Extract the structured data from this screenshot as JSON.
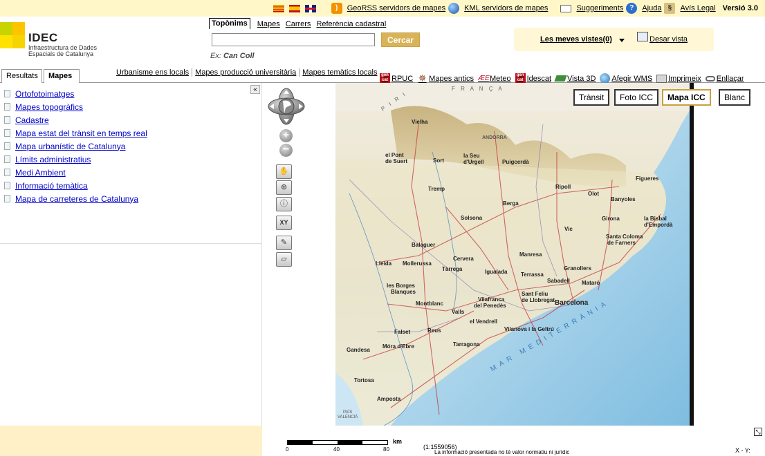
{
  "topbar": {
    "links": {
      "georss": "GeoRSS servidors de mapes",
      "kml": "KML servidors de mapes",
      "suggestions": "Suggeriments",
      "help": "Ajuda",
      "legal": "Avís Legal"
    },
    "version": "Versió 3.0"
  },
  "logo": {
    "title": "IDEC",
    "subtitle_line1": "Infraestructura de Dades",
    "subtitle_line2": "Espacials de Catalunya"
  },
  "search": {
    "tabs": [
      "Topònims",
      "Mapes",
      "Carrers",
      "Referència cadastral"
    ],
    "active_tab": "Topònims",
    "input_value": "",
    "button_label": "Cercar",
    "example_prefix": "Ex:",
    "example_value": "Can Coll"
  },
  "views": {
    "my_views": "Les meves vistes(0)",
    "save_view": "Desar vista"
  },
  "tabs": {
    "resultats": "Resultats",
    "mapes": "Mapes"
  },
  "tool_links": [
    "Urbanisme ens locals",
    "Mapes producció universitària",
    "Mapes temàtics locals"
  ],
  "tool_icons": {
    "rpuc": "RPUC",
    "antics": "Mapes antics",
    "meteo": "Meteo",
    "idescat": "Idescat",
    "vista3d": "Vista 3D",
    "wms": "Afegir WMS",
    "print": "Imprimeix",
    "link": "Enllaçar"
  },
  "maps_list": [
    "Ortofotoimatges",
    "Mapes topogràfics",
    "Cadastre",
    "Mapa estat del trànsit en temps real",
    "Mapa urbanístic de Catalunya",
    "Límits administratius",
    "Medi Ambient",
    "Informació temàtica",
    "Mapa de carreteres de Catalunya"
  ],
  "layer_buttons": {
    "transit": "Trànsit",
    "foto": "Foto ICC",
    "mapa": "Mapa ICC",
    "blanc": "Blanc"
  },
  "map_labels": {
    "vielha": "Vielha",
    "el_pont_de_suert_1": "el Pont",
    "el_pont_de_suert_2": "de Suert",
    "sort": "Sort",
    "la_seu_1": "la Seu",
    "la_seu_2": "d'Urgell",
    "puigcerda": "Puigcerdà",
    "figueres": "Figueres",
    "ripoll": "Ripoll",
    "olot": "Olot",
    "banyoles": "Banyoles",
    "tremp": "Tremp",
    "berga": "Berga",
    "solsona": "Solsona",
    "vic": "Vic",
    "girona": "Girona",
    "la_bisbal_1": "la Bisbal",
    "la_bisbal_2": "d'Empordà",
    "santa_coloma_1": "Santa Coloma",
    "santa_coloma_2": "de Farners",
    "balaguer": "Balaguer",
    "cervera": "Cervera",
    "manresa": "Manresa",
    "lleida": "Lleida",
    "mollerussa": "Mollerussa",
    "tarrega": "Tàrrega",
    "igualada": "Igualada",
    "granollers": "Granollers",
    "terrassa": "Terrassa",
    "sabadell": "Sabadell",
    "mataro": "Mataró",
    "les_borges_1": "les Borges",
    "les_borges_2": "Blanques",
    "sant_feliu_1": "Sant Feliu",
    "sant_feliu_2": "de Llobregat",
    "barcelona": "Barcelona",
    "montblanc": "Montblanc",
    "vilafranca_1": "Vilafranca",
    "vilafranca_2": "del Penedès",
    "valls": "Valls",
    "el_vendrell": "el Vendrell",
    "vilanova": "Vilanova i la Geltrú",
    "falset": "Falset",
    "reus": "Reus",
    "mora_debre": "Móra d'Ebre",
    "tarragona": "Tarragona",
    "gandesa": "Gandesa",
    "tortosa": "Tortosa",
    "amposta": "Amposta",
    "pais_valencia_1": "PAÍS",
    "pais_valencia_2": "VALENCIÀ",
    "franca": "F R A N Ç A",
    "andorra": "ANDORRA",
    "pirineus": "P I R I"
  },
  "sea_label": "MAR MEDITERRÀNIA",
  "scale": {
    "ticks": [
      "0",
      "40",
      "80"
    ],
    "unit": "km",
    "ratio": "(1:1559056)"
  },
  "disclaimer": "La informació presentada no té valor normatiu ni jurídic",
  "coords": "X - Y:"
}
